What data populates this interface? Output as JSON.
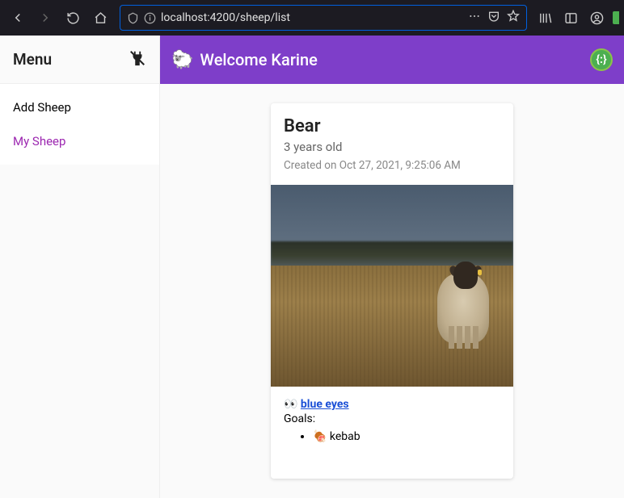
{
  "browser": {
    "url_display": "localhost:4200/sheep/list"
  },
  "sidebar": {
    "title": "Menu",
    "items": [
      {
        "label": "Add Sheep"
      },
      {
        "label": "My Sheep"
      }
    ]
  },
  "topbar": {
    "emoji": "🐑",
    "welcome": "Welcome Karine",
    "badge": "{:}"
  },
  "card": {
    "name": "Bear",
    "age": "3 years old",
    "created": "Created on Oct 27, 2021, 9:25:06 AM",
    "eyes_emoji": "👀",
    "eyes_label": "blue eyes",
    "goals_label": "Goals:",
    "goals": [
      {
        "emoji": "🍖",
        "text": "kebab"
      }
    ]
  }
}
